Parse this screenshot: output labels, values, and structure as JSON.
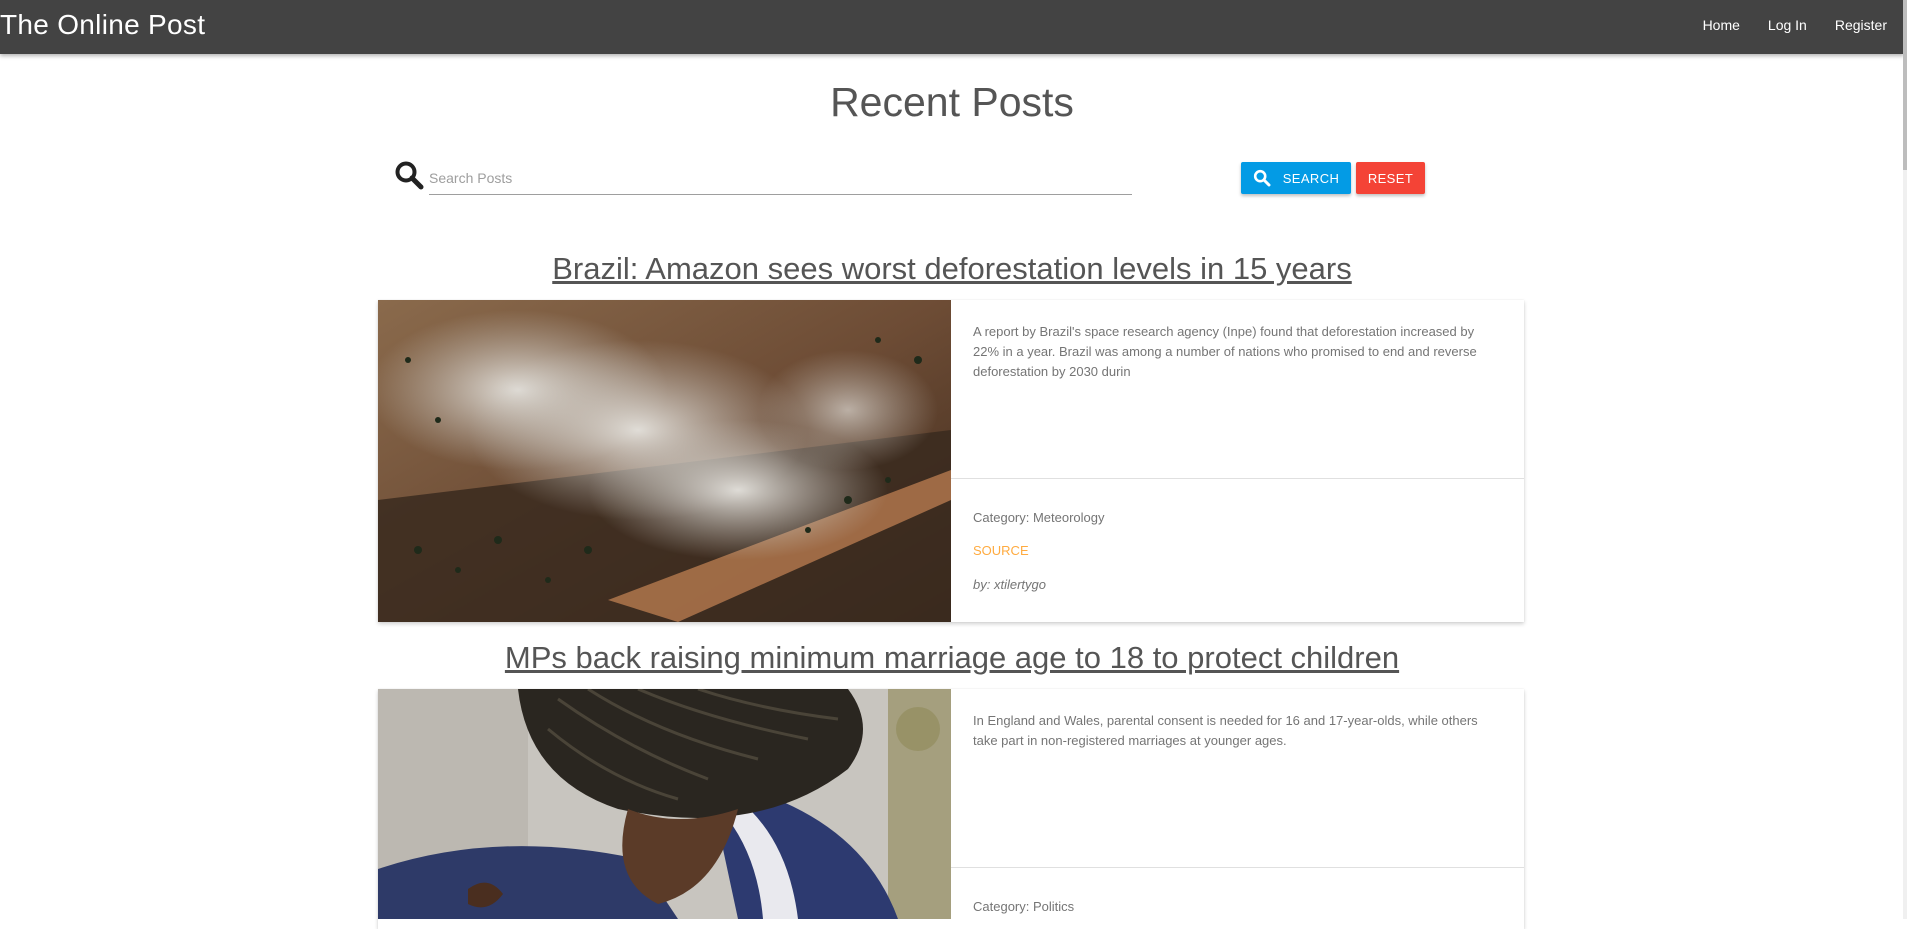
{
  "navbar": {
    "brand": "The Online Post",
    "links": [
      "Home",
      "Log In",
      "Register"
    ]
  },
  "main": {
    "title": "Recent Posts",
    "search": {
      "placeholder": "Search Posts",
      "value": "",
      "search_label": "SEARCH",
      "reset_label": "RESET"
    }
  },
  "posts": [
    {
      "title": "Brazil: Amazon sees worst deforestation levels in 15 years",
      "description": "A report by Brazil's space research agency (Inpe) found that deforestation increased by 22% in a year. Brazil was among a number of nations who promised to end and reverse deforestation by 2030 durin",
      "category": "Category: Meteorology",
      "source_label": "SOURCE",
      "author": "by: xtilertygo",
      "image": "aerial-forest-fire-image"
    },
    {
      "title": "MPs back raising minimum marriage age to 18 to protect children",
      "description": "In England and Wales, parental consent is needed for 16 and 17-year-olds, while others take part in non-registered marriages at younger ages.",
      "category": "Category: Politics",
      "image": "braided-hair-girl-image"
    }
  ],
  "colors": {
    "navbar": "#434343",
    "search_button": "#039be5",
    "reset_button": "#f44336",
    "source_link": "#ffab40"
  }
}
